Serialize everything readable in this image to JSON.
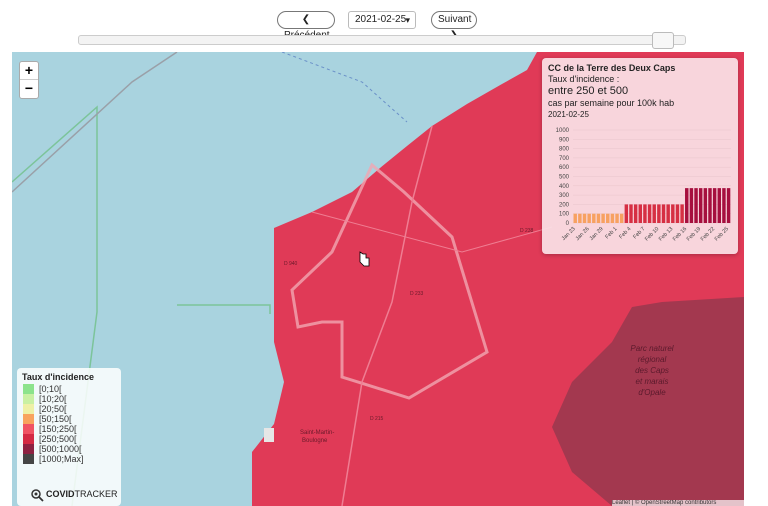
{
  "toolbar": {
    "prev_label": "❮ Précédent",
    "date_value": "2021-02-25",
    "next_label": "Suivant ❯"
  },
  "slider": {
    "position_fraction": 0.98
  },
  "map": {
    "water_color": "#a9d3df",
    "region_color": "#e03a57",
    "park_color": "#a3384f",
    "park_label_lines": [
      "Parc naturel",
      "régional",
      "des Caps",
      "et marais",
      "d'Opale"
    ],
    "place_labels": [
      "Saint-Martin-",
      "Boulogne"
    ],
    "road_labels": [
      "D 940",
      "D 233",
      "D 238",
      "D 215"
    ]
  },
  "zoom": {
    "in_label": "+",
    "out_label": "−"
  },
  "popup": {
    "title": "CC de la Terre des Deux Caps",
    "label": "Taux d'incidence :",
    "range": "entre 250 et 500",
    "unit": "cas par semaine pour 100k hab",
    "date": "2021-02-25"
  },
  "chart_data": {
    "type": "bar",
    "title": "",
    "xlabel": "",
    "ylabel": "",
    "ylim": [
      0,
      1000
    ],
    "yticks": [
      0,
      100,
      200,
      300,
      400,
      500,
      600,
      700,
      800,
      900,
      1000
    ],
    "x_tick_labels": [
      "Jan 23",
      "Jan 26",
      "Jan 29",
      "Feb 1",
      "Feb 4",
      "Feb 7",
      "Feb 10",
      "Feb 13",
      "Feb 16",
      "Feb 19",
      "Feb 22",
      "Feb 25"
    ],
    "categories": [
      "Jan 23",
      "Jan 24",
      "Jan 25",
      "Jan 26",
      "Jan 27",
      "Jan 28",
      "Jan 29",
      "Jan 30",
      "Jan 31",
      "Feb 1",
      "Feb 2",
      "Feb 3",
      "Feb 4",
      "Feb 5",
      "Feb 6",
      "Feb 7",
      "Feb 8",
      "Feb 9",
      "Feb 10",
      "Feb 11",
      "Feb 12",
      "Feb 13",
      "Feb 14",
      "Feb 15",
      "Feb 16",
      "Feb 17",
      "Feb 18",
      "Feb 19",
      "Feb 20",
      "Feb 21",
      "Feb 22",
      "Feb 23",
      "Feb 24",
      "Feb 25"
    ],
    "values": [
      100,
      100,
      100,
      100,
      100,
      100,
      100,
      100,
      100,
      100,
      100,
      200,
      200,
      200,
      200,
      200,
      200,
      200,
      200,
      200,
      200,
      200,
      200,
      200,
      375,
      375,
      375,
      375,
      375,
      375,
      375,
      375,
      375,
      375
    ],
    "colors": {
      "50_150": "#f7a161",
      "150_250": "#d62f43",
      "250_500": "#a60f3e"
    }
  },
  "legend": {
    "title": "Taux d'incidence",
    "items": [
      {
        "label": "[0;10[",
        "color": "#8ce38c"
      },
      {
        "label": "[10;20[",
        "color": "#c9f0a3"
      },
      {
        "label": "[20;50[",
        "color": "#eef0a6"
      },
      {
        "label": "[50;150[",
        "color": "#f8a35e"
      },
      {
        "label": "[150;250[",
        "color": "#f05364"
      },
      {
        "label": "[250;500[",
        "color": "#d42a44"
      },
      {
        "label": "[500;1000[",
        "color": "#8d2242"
      },
      {
        "label": "[1000;Max]",
        "color": "#454545"
      }
    ],
    "brand_bold": "COVID",
    "brand_rest": "TRACKER",
    "brand_icon": "magnifier-virus-icon"
  },
  "attribution": "Leaflet | © OpenStreetMap contributors"
}
